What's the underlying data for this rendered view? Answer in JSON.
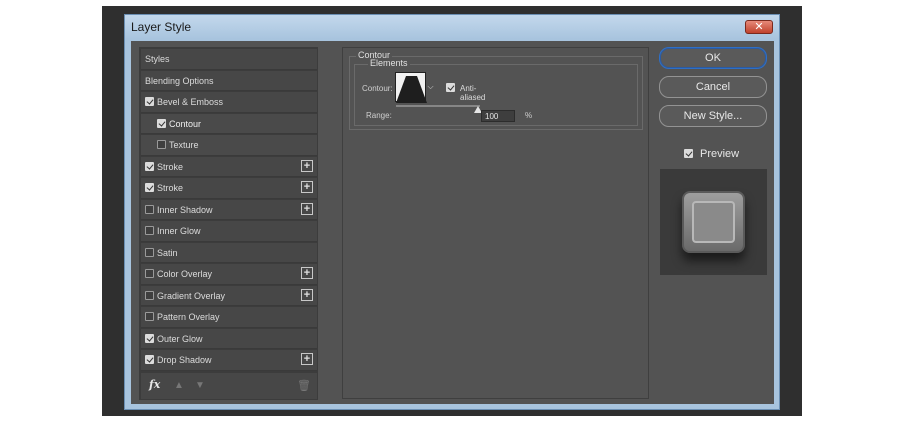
{
  "window": {
    "title": "Layer Style",
    "close_icon": "close-icon"
  },
  "styles_list": {
    "items": [
      {
        "label": "Styles",
        "checkbox": false,
        "checked": false,
        "plus": false,
        "selected": false,
        "sub": false
      },
      {
        "label": "Blending Options",
        "checkbox": false,
        "checked": false,
        "plus": false,
        "selected": false,
        "sub": false
      },
      {
        "label": "Bevel & Emboss",
        "checkbox": true,
        "checked": true,
        "plus": false,
        "selected": false,
        "sub": false
      },
      {
        "label": "Contour",
        "checkbox": true,
        "checked": true,
        "plus": false,
        "selected": true,
        "sub": true
      },
      {
        "label": "Texture",
        "checkbox": true,
        "checked": false,
        "plus": false,
        "selected": false,
        "sub": true
      },
      {
        "label": "Stroke",
        "checkbox": true,
        "checked": true,
        "plus": true,
        "selected": false,
        "sub": false
      },
      {
        "label": "Stroke",
        "checkbox": true,
        "checked": true,
        "plus": true,
        "selected": false,
        "sub": false
      },
      {
        "label": "Inner Shadow",
        "checkbox": true,
        "checked": false,
        "plus": true,
        "selected": false,
        "sub": false
      },
      {
        "label": "Inner Glow",
        "checkbox": true,
        "checked": false,
        "plus": false,
        "selected": false,
        "sub": false
      },
      {
        "label": "Satin",
        "checkbox": true,
        "checked": false,
        "plus": false,
        "selected": false,
        "sub": false
      },
      {
        "label": "Color Overlay",
        "checkbox": true,
        "checked": false,
        "plus": true,
        "selected": false,
        "sub": false
      },
      {
        "label": "Gradient Overlay",
        "checkbox": true,
        "checked": false,
        "plus": true,
        "selected": false,
        "sub": false
      },
      {
        "label": "Pattern Overlay",
        "checkbox": true,
        "checked": false,
        "plus": false,
        "selected": false,
        "sub": false
      },
      {
        "label": "Outer Glow",
        "checkbox": true,
        "checked": true,
        "plus": false,
        "selected": false,
        "sub": false
      },
      {
        "label": "Drop Shadow",
        "checkbox": true,
        "checked": true,
        "plus": true,
        "selected": false,
        "sub": false
      }
    ],
    "footer": {
      "fx_label": "fx",
      "icons": [
        "fx-icon",
        "move-up-icon",
        "move-down-icon",
        "trash-icon"
      ]
    }
  },
  "contour_panel": {
    "group_title": "Contour",
    "subgroup_title": "Elements",
    "contour_label": "Contour:",
    "anti_aliased_label": "Anti-aliased",
    "anti_aliased_checked": true,
    "range_label": "Range:",
    "range_value": "100",
    "range_unit": "%",
    "range_fraction": 1.0
  },
  "buttons": {
    "ok": "OK",
    "cancel": "Cancel",
    "new_style": "New Style..."
  },
  "preview": {
    "label": "Preview",
    "checked": true
  },
  "colors": {
    "dialog_bg": "#535353",
    "panel_dark": "#3c3c3c",
    "selected_item": "#686868",
    "title_bar": "#a8c4de",
    "ok_border": "#2f6fc5"
  }
}
